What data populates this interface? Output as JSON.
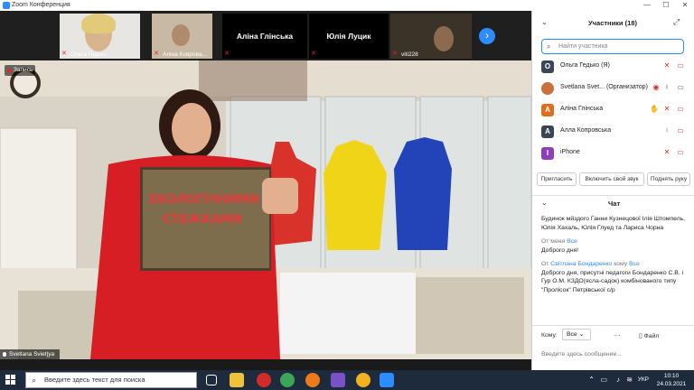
{
  "window": {
    "title": "Zoom Конференция"
  },
  "thumbnails": [
    {
      "name": "Ольга Гедько",
      "muted": true
    },
    {
      "name": "Аліна Коврова...",
      "muted": true
    },
    {
      "name": "Аліна Глінська",
      "muted": true
    },
    {
      "name": "Юлія Луцик",
      "muted": true
    },
    {
      "name": "viti228",
      "muted": true
    }
  ],
  "main_video": {
    "recording_label": "Запись",
    "speaker_name": "Svetlana Sviet|ya"
  },
  "participants": {
    "title": "Участники (18)",
    "search_placeholder": "Найти участника",
    "list": [
      {
        "initial": "О",
        "name": "Ольга Гедько (Я)",
        "color": "#3b4654"
      },
      {
        "initial": "",
        "name": "Svetlana Svet...  (Организатор)",
        "color": "#c9703c"
      },
      {
        "initial": "А",
        "name": "Аліна Глінська",
        "color": "#e06d1b"
      },
      {
        "initial": "А",
        "name": "Алла Копровська",
        "color": "#3b4654"
      },
      {
        "initial": "I",
        "name": "iPhone",
        "color": "#8b3fb8"
      }
    ],
    "buttons": {
      "invite": "Пригласить",
      "unmute": "Включить свой звук",
      "raise_hand": "Поднять руку"
    }
  },
  "chat": {
    "title": "Чат",
    "messages": [
      {
        "from": "",
        "sender": "",
        "to": "",
        "text": "Будинок мйздого Ганни Кузнецової Ілія Штомпель, Юлія Хахаль, Юлія Глуед та Лариса Чорна"
      },
      {
        "from": "От меня",
        "sender": "",
        "to": "Все",
        "text": "Доброго дня!"
      },
      {
        "from": "От",
        "sender": "Світлана Бондаренко",
        "to": "Все",
        "text": "Доброго дня, присутні педагоги Бондаренко С.В. і Гур О.М. КЗДО(ясла-садок) комбінованого типу \"Пролісок\" Петрівської с/р"
      }
    ],
    "to_label": "Кому:",
    "to_value": "Все",
    "file_label": "Файл",
    "input_placeholder": "Введите здесь сообщение..."
  },
  "taskbar": {
    "search_placeholder": "Введите здесь текст для поиска",
    "language": "УКР",
    "time": "10:10",
    "date": "24.03.2021"
  },
  "colors": {
    "accent": "#2d8cff",
    "muted_red": "#e02828",
    "taskbar": "#1e2b3c"
  }
}
